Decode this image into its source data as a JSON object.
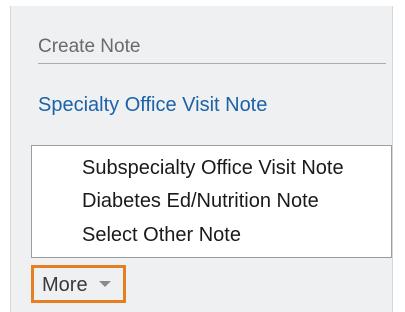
{
  "create_note": {
    "header": "Create Note",
    "primary_link": "Specialty Office Visit Note"
  },
  "menu": {
    "items": [
      {
        "label": "Subspecialty Office Visit Note"
      },
      {
        "label": "Diabetes Ed/Nutrition Note"
      },
      {
        "label": "Select Other Note"
      }
    ]
  },
  "more": {
    "label": "More",
    "icon": "chevron-down-icon",
    "highlight_color": "#e67e22"
  },
  "colors": {
    "link": "#1c62a8",
    "panel_background": "#eef0f1"
  }
}
